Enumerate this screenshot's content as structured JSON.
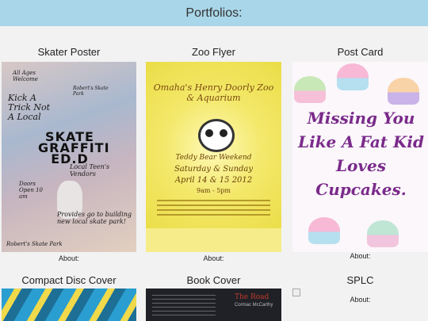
{
  "header": {
    "title": "Portfolios:"
  },
  "cards": [
    {
      "title": "Skater Poster",
      "about": "About:",
      "poster_lines": [
        "All Ages Welcome",
        "Kick A Trick Not A Local",
        "Robert's Skate Park",
        "SKATE GRAFFITI ED.D",
        "Local Teen's Vendors",
        "Doors Open 10 am",
        "Provides go to building new local skate park!",
        "Robert's Skate Park"
      ]
    },
    {
      "title": "Zoo Flyer",
      "about": "About:",
      "flyer_title": "Omaha's Henry Doorly Zoo & Aquarium",
      "event": "Teddy Bear Weekend",
      "days": "Saturday & Sunday",
      "dates": "April 14 & 15 2012",
      "hours": "9am - 5pm"
    },
    {
      "title": "Post Card",
      "about": "About:",
      "card_text": "Missing You Like A Fat Kid Loves Cupcakes."
    },
    {
      "title": "Compact Disc Cover"
    },
    {
      "title": "Book Cover",
      "book_title": "The Road",
      "book_author": "Cormac McCarthy"
    },
    {
      "title": "SPLC",
      "about": "About:"
    }
  ]
}
